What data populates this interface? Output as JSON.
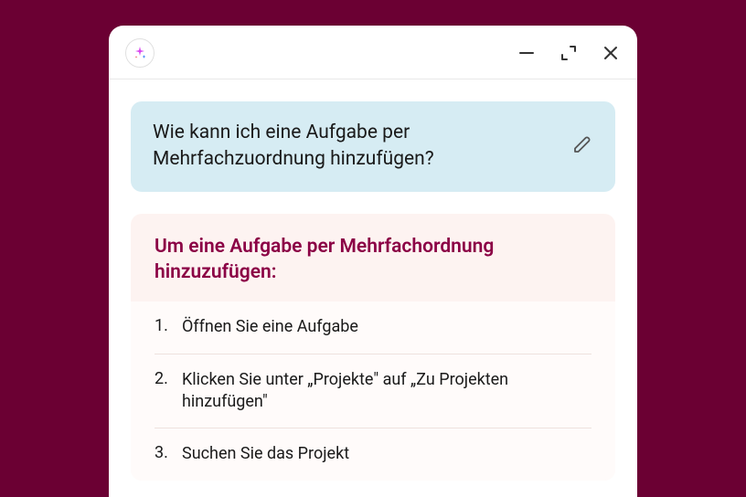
{
  "question": {
    "text": "Wie kann ich eine Aufgabe per Mehrfachzuordnung hinzufügen?"
  },
  "answer": {
    "title": "Um eine Aufgabe per Mehrfachordnung hinzuzufügen:",
    "steps": [
      {
        "num": "1.",
        "text": "Öffnen Sie eine Aufgabe"
      },
      {
        "num": "2.",
        "text": "Klicken Sie unter „Projekte\" auf „Zu Projekten hinzufügen\""
      },
      {
        "num": "3.",
        "text": "Suchen Sie das Projekt"
      }
    ]
  }
}
